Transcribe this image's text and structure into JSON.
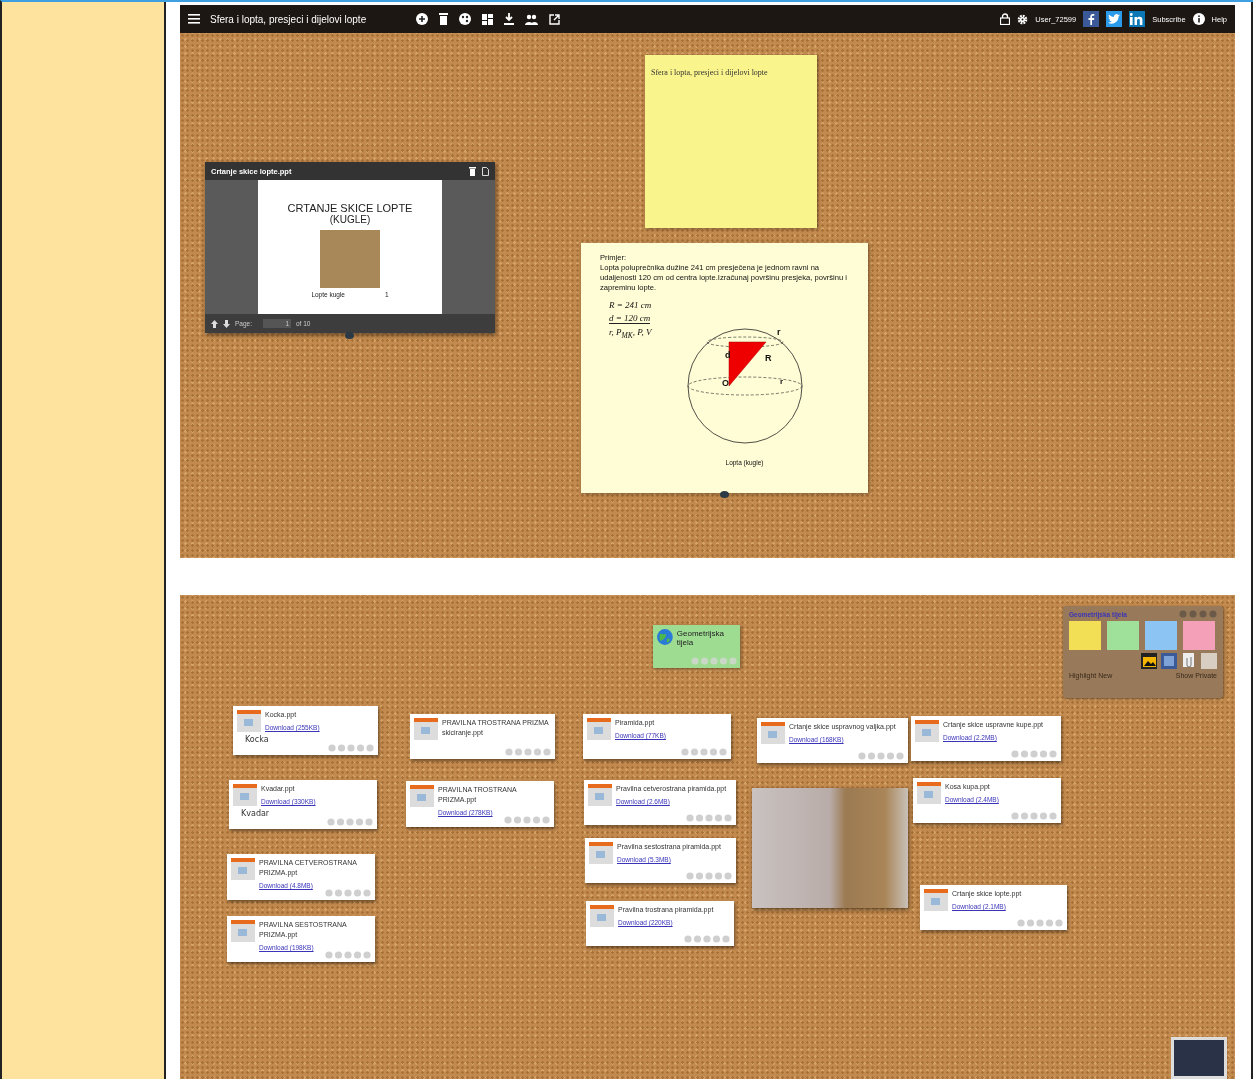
{
  "toolbar": {
    "title": "Sfera i lopta, presjeci i dijelovi lopte",
    "user": "User_72599",
    "subscribe": "Subscribe",
    "help": "Help"
  },
  "sticky_note": {
    "text": "Sfera i lopta, presjeci i dijelovi lopte"
  },
  "ppt_viewer": {
    "title": "Crtanje skice lopte.ppt",
    "slide_title": "CRTANJE SKICE LOPTE",
    "slide_subtitle": "(KUGLE)",
    "slide_caption": "Lopte kugle",
    "slide_number": "1",
    "page_label": "Page:",
    "page_value": "1",
    "page_total": "of 10"
  },
  "example": {
    "heading": "Primjer:",
    "text": "Lopta poluprečnika dužine 241 cm presječena je jednom ravni na udaljenosti 120 cm od centra lopte.Izračunaj površinu presjeka, površinu i zapreminu lopte.",
    "formulas": [
      "R = 241 cm",
      "d = 120 cm",
      "r, P$_{MK}$, P, V"
    ],
    "diagram_labels": [
      "r",
      "d",
      "R",
      "O",
      "r"
    ],
    "caption": "Lopta (kugle)"
  },
  "board": {
    "topic": "Geometrijska tijela",
    "cards": [
      {
        "title": "Kocka.ppt",
        "download": "Download (255KB)",
        "note": "Kocka"
      },
      {
        "title": "Kvadar.ppt",
        "download": "Download (330KB)",
        "note": "Kvadar"
      },
      {
        "title": "PRAVILNA CETVEROSTRANA PRIZMA.ppt",
        "download": "Download (4.8MB)"
      },
      {
        "title": "PRAVILNA SESTOSTRANA PRIZMA.ppt",
        "download": "Download (198KB)"
      },
      {
        "title": "PRAVILNA TROSTRANA PRIZMA skiciranje.ppt"
      },
      {
        "title": "PRAVILNA TROSTRANA PRIZMA.ppt",
        "download": "Download (278KB)"
      },
      {
        "title": "Piramida.ppt",
        "download": "Download (77KB)"
      },
      {
        "title": "Pravilna cetverostrana piramida.ppt",
        "download": "Download (2.6MB)"
      },
      {
        "title": "Pravilna sestostrana piramida.ppt",
        "download": "Download (5.3MB)"
      },
      {
        "title": "Pravilna trostrana piramida.ppt",
        "download": "Download (220KB)"
      },
      {
        "title": "Crtanje skice uspravnog valjka.ppt",
        "download": "Download (168KB)"
      },
      {
        "title": "Crtanje skice uspravne kupe.ppt",
        "download": "Download (2.2MB)"
      },
      {
        "title": "Kosa kupa.ppt",
        "download": "Download (2.4MB)"
      },
      {
        "title": "Crtanje skice lopte.ppt",
        "download": "Download (2.1MB)"
      }
    ],
    "panel": {
      "title": "Geometrijska tijela",
      "notes": [
        {
          "color": "#f3df55"
        },
        {
          "color": "#9fe09a"
        },
        {
          "color": "#8cc4f4"
        },
        {
          "color": "#f3a0b8"
        }
      ],
      "highlight": "Highlight New",
      "private": "Show Private"
    }
  }
}
